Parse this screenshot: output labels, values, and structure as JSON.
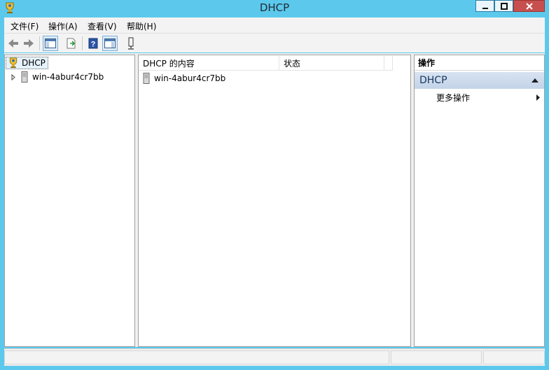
{
  "window": {
    "title": "DHCP"
  },
  "colors": {
    "titlebar": "#5cc9ec",
    "close_button": "#c7504e",
    "section_header": "#c8d7ea"
  },
  "menu": [
    {
      "label": "文件(F)"
    },
    {
      "label": "操作(A)"
    },
    {
      "label": "查看(V)"
    },
    {
      "label": "帮助(H)"
    }
  ],
  "toolbar": {
    "icons": [
      "back-arrow-icon",
      "forward-arrow-icon",
      "show-console-tree-icon",
      "export-list-icon",
      "help-icon",
      "show-action-pane-icon",
      "server-status-icon"
    ]
  },
  "tree": {
    "root": {
      "label": "DHCP",
      "icon": "dhcp-icon"
    },
    "children": [
      {
        "label": "win-4abur4cr7bb",
        "icon": "server-icon"
      }
    ]
  },
  "content": {
    "columns": [
      {
        "label": "DHCP 的内容"
      },
      {
        "label": "状态"
      }
    ],
    "rows": [
      {
        "name": "win-4abur4cr7bb",
        "status": ""
      }
    ]
  },
  "actions": {
    "title": "操作",
    "section": "DHCP",
    "items": [
      {
        "label": "更多操作"
      }
    ]
  }
}
